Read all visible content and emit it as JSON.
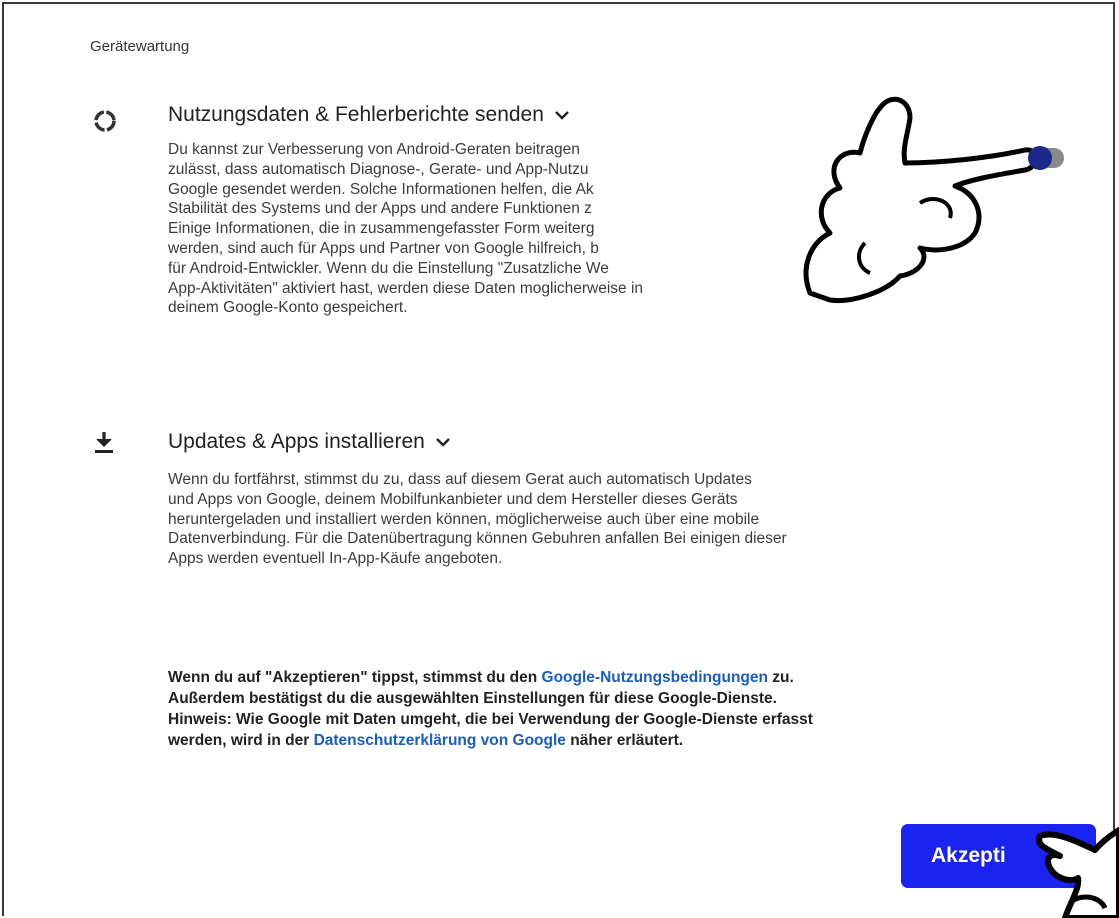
{
  "section": {
    "title": "Gerätewartung"
  },
  "items": [
    {
      "icon": "loading-ring-icon",
      "title": "Nutzungsdaten & Fehlerberichte senden",
      "expand_icon": "chevron-down-icon",
      "lines": [
        "Du kannst zur Verbesserung von Android-Geraten beitragen",
        "zulässt, dass automatisch Diagnose-, Gerate- und App-Nutzu",
        "Google gesendet werden. Solche Informationen helfen, die Ak",
        "Stabilität des Systems und der Apps und andere Funktionen z",
        "Einige Informationen, die in zusammengefasster Form weiterg",
        "werden, sind auch für Apps und Partner von Google hilfreich, b",
        "für Android-Entwickler. Wenn du die Einstellung \"Zusatzliche We",
        "App-Aktivitäten\" aktiviert hast, werden diese Daten moglicherweise in",
        "deinem Google-Konto gespeichert."
      ],
      "toggle_on": true
    },
    {
      "icon": "download-icon",
      "title": "Updates & Apps installieren",
      "expand_icon": "chevron-down-icon",
      "lines": [
        "Wenn du fortfährst, stimmst du zu, dass auf diesem Gerat auch automatisch Updates",
        "und Apps von Google, deinem Mobilfunkanbieter und dem Hersteller dieses Geräts",
        "heruntergeladen und installiert werden können, möglicherweise auch über eine mobile",
        "Datenverbindung. Für die Datenübertragung können Gebuhren anfallen  Bei einigen dieser",
        "Apps werden eventuell In-App-Käufe angeboten."
      ]
    }
  ],
  "terms": {
    "line1_pre": "Wenn du auf \"Akzeptieren\" tippst, stimmst du den ",
    "line1_link": "Google-Nutzungsbedingungen",
    "line1_post": " zu.",
    "line2": "Außerdem bestätigst du die ausgewählten Einstellungen für diese Google-Dienste.",
    "line3": "Hinweis: Wie Google mit Daten umgeht, die bei Verwendung der Google-Dienste erfasst",
    "line4_pre": "werden, wird in der ",
    "line4_link": "Datenschutzerklärung von Google",
    "line4_post": " näher erläutert."
  },
  "accept_button": {
    "label": "Akzepti"
  },
  "overlay_icons": [
    "pointing-hand-icon",
    "pointing-hand-icon"
  ],
  "colors": {
    "accent": "#1b23f0",
    "link": "#1a5dbf",
    "toggle_knob": "#1b2a8a"
  }
}
